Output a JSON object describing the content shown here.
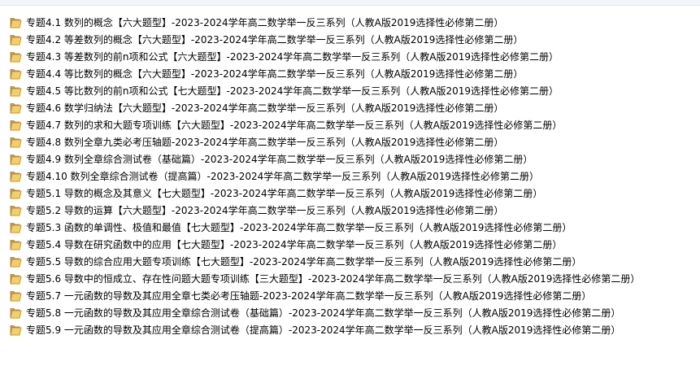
{
  "folder_icon": "folder-icon",
  "folder_color": "#d9a83a",
  "files": [
    "专题4.1 数列的概念【六大题型】-2023-2024学年高二数学举一反三系列（人教A版2019选择性必修第二册）",
    "专题4.2 等差数列的概念【六大题型】-2023-2024学年高二数学举一反三系列（人教A版2019选择性必修第二册）",
    "专题4.3 等差数列的前n项和公式【六大题型】-2023-2024学年高二数学举一反三系列（人教A版2019选择性必修第二册）",
    "专题4.4 等比数列的概念【六大题型】-2023-2024学年高二数学举一反三系列（人教A版2019选择性必修第二册）",
    "专题4.5 等比数列的前n项和公式【七大题型】-2023-2024学年高二数学举一反三系列（人教A版2019选择性必修第二册）",
    "专题4.6 数学归纳法【六大题型】-2023-2024学年高二数学举一反三系列（人教A版2019选择性必修第二册）",
    "专题4.7 数列的求和大题专项训练【六大题型】-2023-2024学年高二数学举一反三系列（人教A版2019选择性必修第二册）",
    "专题4.8 数列全章九类必考压轴题-2023-2024学年高二数学举一反三系列（人教A版2019选择性必修第二册）",
    "专题4.9 数列全章综合测试卷（基础篇）-2023-2024学年高二数学举一反三系列（人教A版2019选择性必修第二册）",
    "专题4.10 数列全章综合测试卷（提高篇）-2023-2024学年高二数学举一反三系列（人教A版2019选择性必修第二册）",
    "专题5.1 导数的概念及其意义【七大题型】-2023-2024学年高二数学举一反三系列（人教A版2019选择性必修第二册）",
    "专题5.2 导数的运算【六大题型】-2023-2024学年高二数学举一反三系列（人教A版2019选择性必修第二册）",
    "专题5.3 函数的单调性、极值和最值【七大题型】-2023-2024学年高二数学举一反三系列（人教A版2019选择性必修第二册）",
    "专题5.4 导数在研究函数中的应用【七大题型】-2023-2024学年高二数学举一反三系列（人教A版2019选择性必修第二册）",
    "专题5.5 导数的综合应用大题专项训练【七大题型】-2023-2024学年高二数学举一反三系列（人教A版2019选择性必修第二册）",
    "专题5.6 导数中的恒成立、存在性问题大题专项训练【三大题型】-2023-2024学年高二数学举一反三系列（人教A版2019选择性必修第二册）",
    "专题5.7 一元函数的导数及其应用全章七类必考压轴题-2023-2024学年高二数学举一反三系列（人教A版2019选择性必修第二册）",
    "专题5.8 一元函数的导数及其应用全章综合测试卷（基础篇）-2023-2024学年高二数学举一反三系列（人教A版2019选择性必修第二册）",
    "专题5.9 一元函数的导数及其应用全章综合测试卷（提高篇）-2023-2024学年高二数学举一反三系列（人教A版2019选择性必修第二册）"
  ]
}
